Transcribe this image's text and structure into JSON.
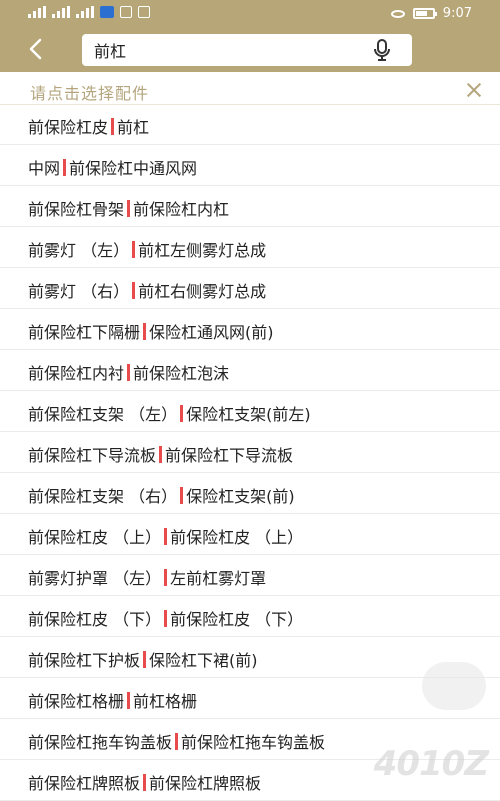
{
  "status_bar": {
    "time": "9:07",
    "battery_level_percent": 70
  },
  "search": {
    "value": "前杠",
    "placeholder": ""
  },
  "hint": {
    "text": "请点击选择配件"
  },
  "items": [
    {
      "left": "前保险杠皮",
      "right": "前杠"
    },
    {
      "left": "中网",
      "right": "前保险杠中通风网"
    },
    {
      "left": "前保险杠骨架",
      "right": "前保险杠内杠"
    },
    {
      "left": "前雾灯 （左）",
      "right": "前杠左侧雾灯总成"
    },
    {
      "left": "前雾灯 （右）",
      "right": "前杠右侧雾灯总成"
    },
    {
      "left": "前保险杠下隔栅",
      "right": "保险杠通风网(前)"
    },
    {
      "left": "前保险杠内衬",
      "right": "前保险杠泡沫"
    },
    {
      "left": "前保险杠支架 （左）",
      "right": "保险杠支架(前左)"
    },
    {
      "left": "前保险杠下导流板",
      "right": "前保险杠下导流板"
    },
    {
      "left": "前保险杠支架 （右）",
      "right": "保险杠支架(前)"
    },
    {
      "left": "前保险杠皮 （上）",
      "right": "前保险杠皮 （上）"
    },
    {
      "left": "前雾灯护罩 （左）",
      "right": "左前杠雾灯罩"
    },
    {
      "left": "前保险杠皮 （下）",
      "right": "前保险杠皮 （下）"
    },
    {
      "left": "前保险杠下护板",
      "right": "保险杠下裙(前)"
    },
    {
      "left": "前保险杠格栅",
      "right": "前杠格栅"
    },
    {
      "left": "前保险杠拖车钩盖板",
      "right": "前保险杠拖车钩盖板"
    },
    {
      "left": "前保险杠牌照板",
      "right": "前保险杠牌照板"
    }
  ],
  "watermark": "4010Z",
  "colors": {
    "header": "#b7a677",
    "hint_text": "#b4a57d",
    "separator": "#e74b4b"
  }
}
